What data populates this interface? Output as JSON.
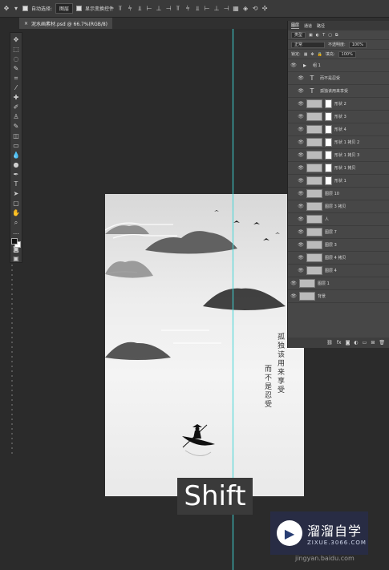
{
  "options_bar": {
    "auto_select_label": "自动选择:",
    "auto_select_value": "图层",
    "show_transform_label": "显示变换控件"
  },
  "document_tab": {
    "label": "泥水画素材.psd @ 66.7%(RGB/8)",
    "close": "×"
  },
  "artwork": {
    "poem_right": "孤独该用来享受",
    "poem_left": "而不是忍受"
  },
  "layers_panel": {
    "tabs": [
      "图层",
      "通道",
      "路径"
    ],
    "filter_label": "类型",
    "blend_mode": "正常",
    "opacity_label": "不透明度:",
    "opacity_value": "100%",
    "lock_label": "锁定:",
    "fill_label": "填充:",
    "fill_value": "100%",
    "layers": [
      {
        "name": "组 1",
        "kind": "group",
        "indent": false
      },
      {
        "name": "而不是忍受",
        "kind": "text",
        "indent": true
      },
      {
        "name": "孤独该用来享受",
        "kind": "text",
        "indent": true
      },
      {
        "name": "形状 2",
        "kind": "shape",
        "indent": true
      },
      {
        "name": "形状 3",
        "kind": "shape",
        "indent": true
      },
      {
        "name": "形状 4",
        "kind": "shape",
        "indent": true
      },
      {
        "name": "形状 1 拷贝 2",
        "kind": "shape",
        "indent": true
      },
      {
        "name": "形状 1 拷贝 3",
        "kind": "shape",
        "indent": true
      },
      {
        "name": "形状 1 拷贝",
        "kind": "shape",
        "indent": true
      },
      {
        "name": "形状 1",
        "kind": "shape",
        "indent": true
      },
      {
        "name": "图层 10",
        "kind": "pixel",
        "indent": true
      },
      {
        "name": "图层 3 拷贝",
        "kind": "pixel",
        "indent": true
      },
      {
        "name": "人",
        "kind": "pixel",
        "indent": true
      },
      {
        "name": "图层 7",
        "kind": "pixel",
        "indent": true
      },
      {
        "name": "图层 3",
        "kind": "pixel",
        "indent": true
      },
      {
        "name": "图层 4 拷贝",
        "kind": "pixel",
        "indent": true
      },
      {
        "name": "图层 4",
        "kind": "pixel",
        "indent": true
      },
      {
        "name": "图层 1",
        "kind": "pixel",
        "indent": false
      },
      {
        "name": "背景",
        "kind": "pixel",
        "indent": false
      }
    ],
    "footer_icons": [
      "link-icon",
      "fx-icon",
      "mask-icon",
      "adjust-icon",
      "folder-icon",
      "new-layer-icon",
      "trash-icon"
    ]
  },
  "caption": "Shift",
  "logo": {
    "title": "溜溜自学",
    "subtitle": "ZIXUE.3066.COM"
  },
  "watermark": "jingyan.baidu.com"
}
